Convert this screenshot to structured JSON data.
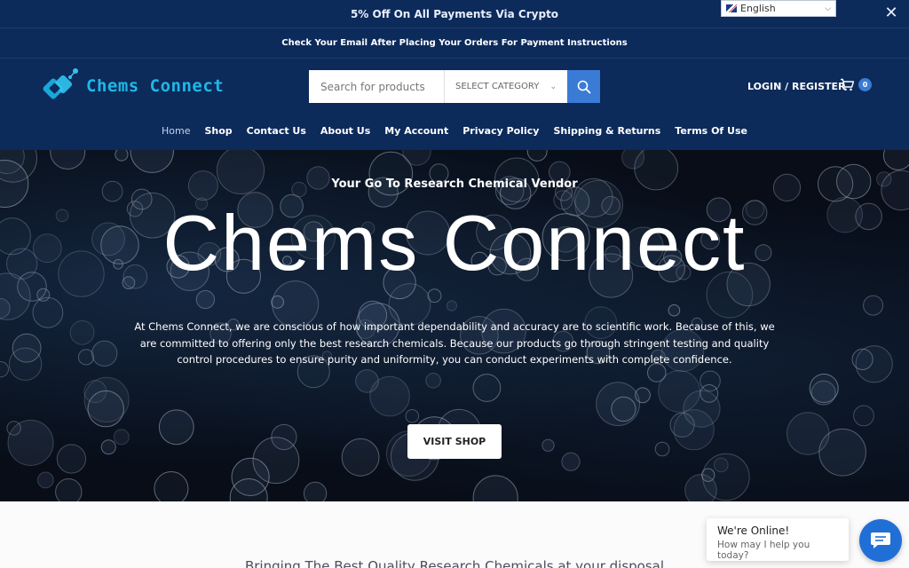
{
  "promo": {
    "text": "5% Off On All Payments Via Crypto",
    "close_icon": "close-icon"
  },
  "language": {
    "selected": "English",
    "flag_icon": "uk-flag-icon"
  },
  "notice": {
    "text": "Check Your Email After Placing Your Orders For Payment Instructions"
  },
  "brand": {
    "name": "Chems Connect",
    "logo_icon": "molecule-logo-icon"
  },
  "search": {
    "placeholder": "Search for products",
    "category": "SELECT CATEGORY",
    "button_icon": "search-icon"
  },
  "account": {
    "login_label": "LOGIN / REGISTER",
    "cart_icon": "cart-icon",
    "cart_count": "0"
  },
  "nav": {
    "items": [
      {
        "label": "Home"
      },
      {
        "label": "Shop"
      },
      {
        "label": "Contact Us"
      },
      {
        "label": "About Us"
      },
      {
        "label": "My Account"
      },
      {
        "label": "Privacy Policy"
      },
      {
        "label": "Shipping & Returns"
      },
      {
        "label": "Terms Of Use"
      }
    ],
    "active": "Home"
  },
  "hero": {
    "tagline": "Your Go To Research Chemical Vendor",
    "title": "Chems Connect",
    "body": "At Chems Connect, we are conscious of how important dependability and accuracy are to scientific work. Because of this, we are committed to offering only the best research chemicals. Because our products go through stringent testing and quality control procedures to ensure purity and uniformity, you can conduct experiments with complete confidence.",
    "button": "VISIT SHOP"
  },
  "section": {
    "heading": "Bringing The Best Quality Research Chemicals at your disposal"
  },
  "chat": {
    "title": "We're Online!",
    "subtitle": "How may I help you today?",
    "icon": "chat-icon"
  },
  "colors": {
    "navy": "#0c2a5a",
    "accent": "#3a7bd5",
    "logo": "#1eb8e6",
    "chat": "#1f6fd6"
  }
}
